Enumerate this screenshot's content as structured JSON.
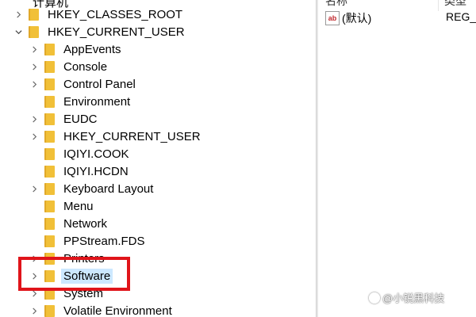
{
  "tree": {
    "top_partial": "计算机",
    "roots": [
      {
        "label": "HKEY_CLASSES_ROOT",
        "expanded": false
      },
      {
        "label": "HKEY_CURRENT_USER",
        "expanded": true
      }
    ],
    "children": [
      {
        "label": "AppEvents",
        "has_children": true
      },
      {
        "label": "Console",
        "has_children": true
      },
      {
        "label": "Control Panel",
        "has_children": true
      },
      {
        "label": "Environment",
        "has_children": false
      },
      {
        "label": "EUDC",
        "has_children": true
      },
      {
        "label": "HKEY_CURRENT_USER",
        "has_children": true
      },
      {
        "label": "IQIYI.COOK",
        "has_children": false
      },
      {
        "label": "IQIYI.HCDN",
        "has_children": false
      },
      {
        "label": "Keyboard Layout",
        "has_children": true
      },
      {
        "label": "Menu",
        "has_children": false
      },
      {
        "label": "Network",
        "has_children": false
      },
      {
        "label": "PPStream.FDS",
        "has_children": false
      },
      {
        "label": "Printers",
        "has_children": true
      },
      {
        "label": "Software",
        "has_children": true,
        "selected": true
      },
      {
        "label": "System",
        "has_children": true
      },
      {
        "label": "Volatile Environment",
        "has_children": true
      }
    ],
    "highlight_color": "#e0141a"
  },
  "values_pane": {
    "col_name": "名称",
    "col_type": "类型",
    "rows": [
      {
        "icon": "string-value-icon",
        "icon_text": "ab",
        "name": "(默认)",
        "type": "REG_S"
      }
    ]
  },
  "watermark": "@小锐黑科技"
}
